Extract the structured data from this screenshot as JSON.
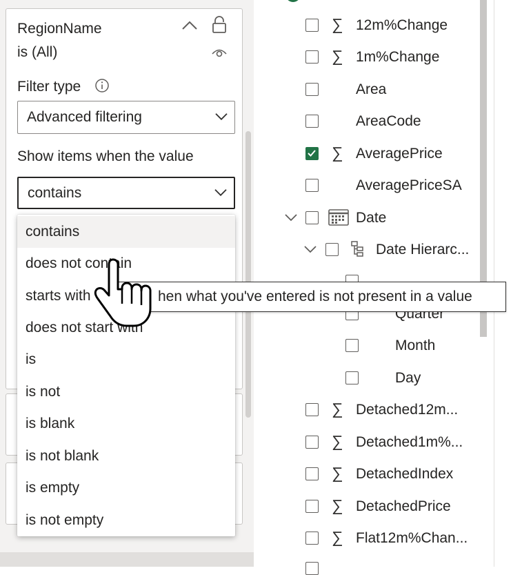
{
  "filter_card": {
    "field_name": "RegionName",
    "field_state": "is (All)",
    "filter_type_label": "Filter type",
    "filter_type_value": "Advanced filtering",
    "show_items_label": "Show items when the value",
    "operator_value": "contains"
  },
  "operator_options": [
    "contains",
    "does not contain",
    "starts with",
    "does not start with",
    "is",
    "is not",
    "is blank",
    "is not blank",
    "is empty",
    "is not empty"
  ],
  "tooltip_text": "hen what you've entered is not present in a value",
  "fields": [
    {
      "label": "12m%Change",
      "checked": false,
      "sigma": true
    },
    {
      "label": "1m%Change",
      "checked": false,
      "sigma": true
    },
    {
      "label": "Area",
      "checked": false,
      "sigma": false
    },
    {
      "label": "AreaCode",
      "checked": false,
      "sigma": false
    },
    {
      "label": "AveragePrice",
      "checked": true,
      "sigma": true
    },
    {
      "label": "AveragePriceSA",
      "checked": false,
      "sigma": false
    },
    {
      "label": "Date",
      "checked": false,
      "sigma": false
    },
    {
      "label": "Date Hierarc...",
      "checked": false,
      "sigma": false
    },
    {
      "label": "Quarter",
      "checked": false,
      "sigma": false
    },
    {
      "label": "Month",
      "checked": false,
      "sigma": false
    },
    {
      "label": "Day",
      "checked": false,
      "sigma": false
    },
    {
      "label": "Detached12m...",
      "checked": false,
      "sigma": true
    },
    {
      "label": "Detached1m%...",
      "checked": false,
      "sigma": true
    },
    {
      "label": "DetachedIndex",
      "checked": false,
      "sigma": true
    },
    {
      "label": "DetachedPrice",
      "checked": false,
      "sigma": true
    },
    {
      "label": "Flat12m%Chan...",
      "checked": false,
      "sigma": true
    }
  ],
  "colors": {
    "checkbox_checked": "#217346",
    "pane_background": "#f3f2f1"
  }
}
